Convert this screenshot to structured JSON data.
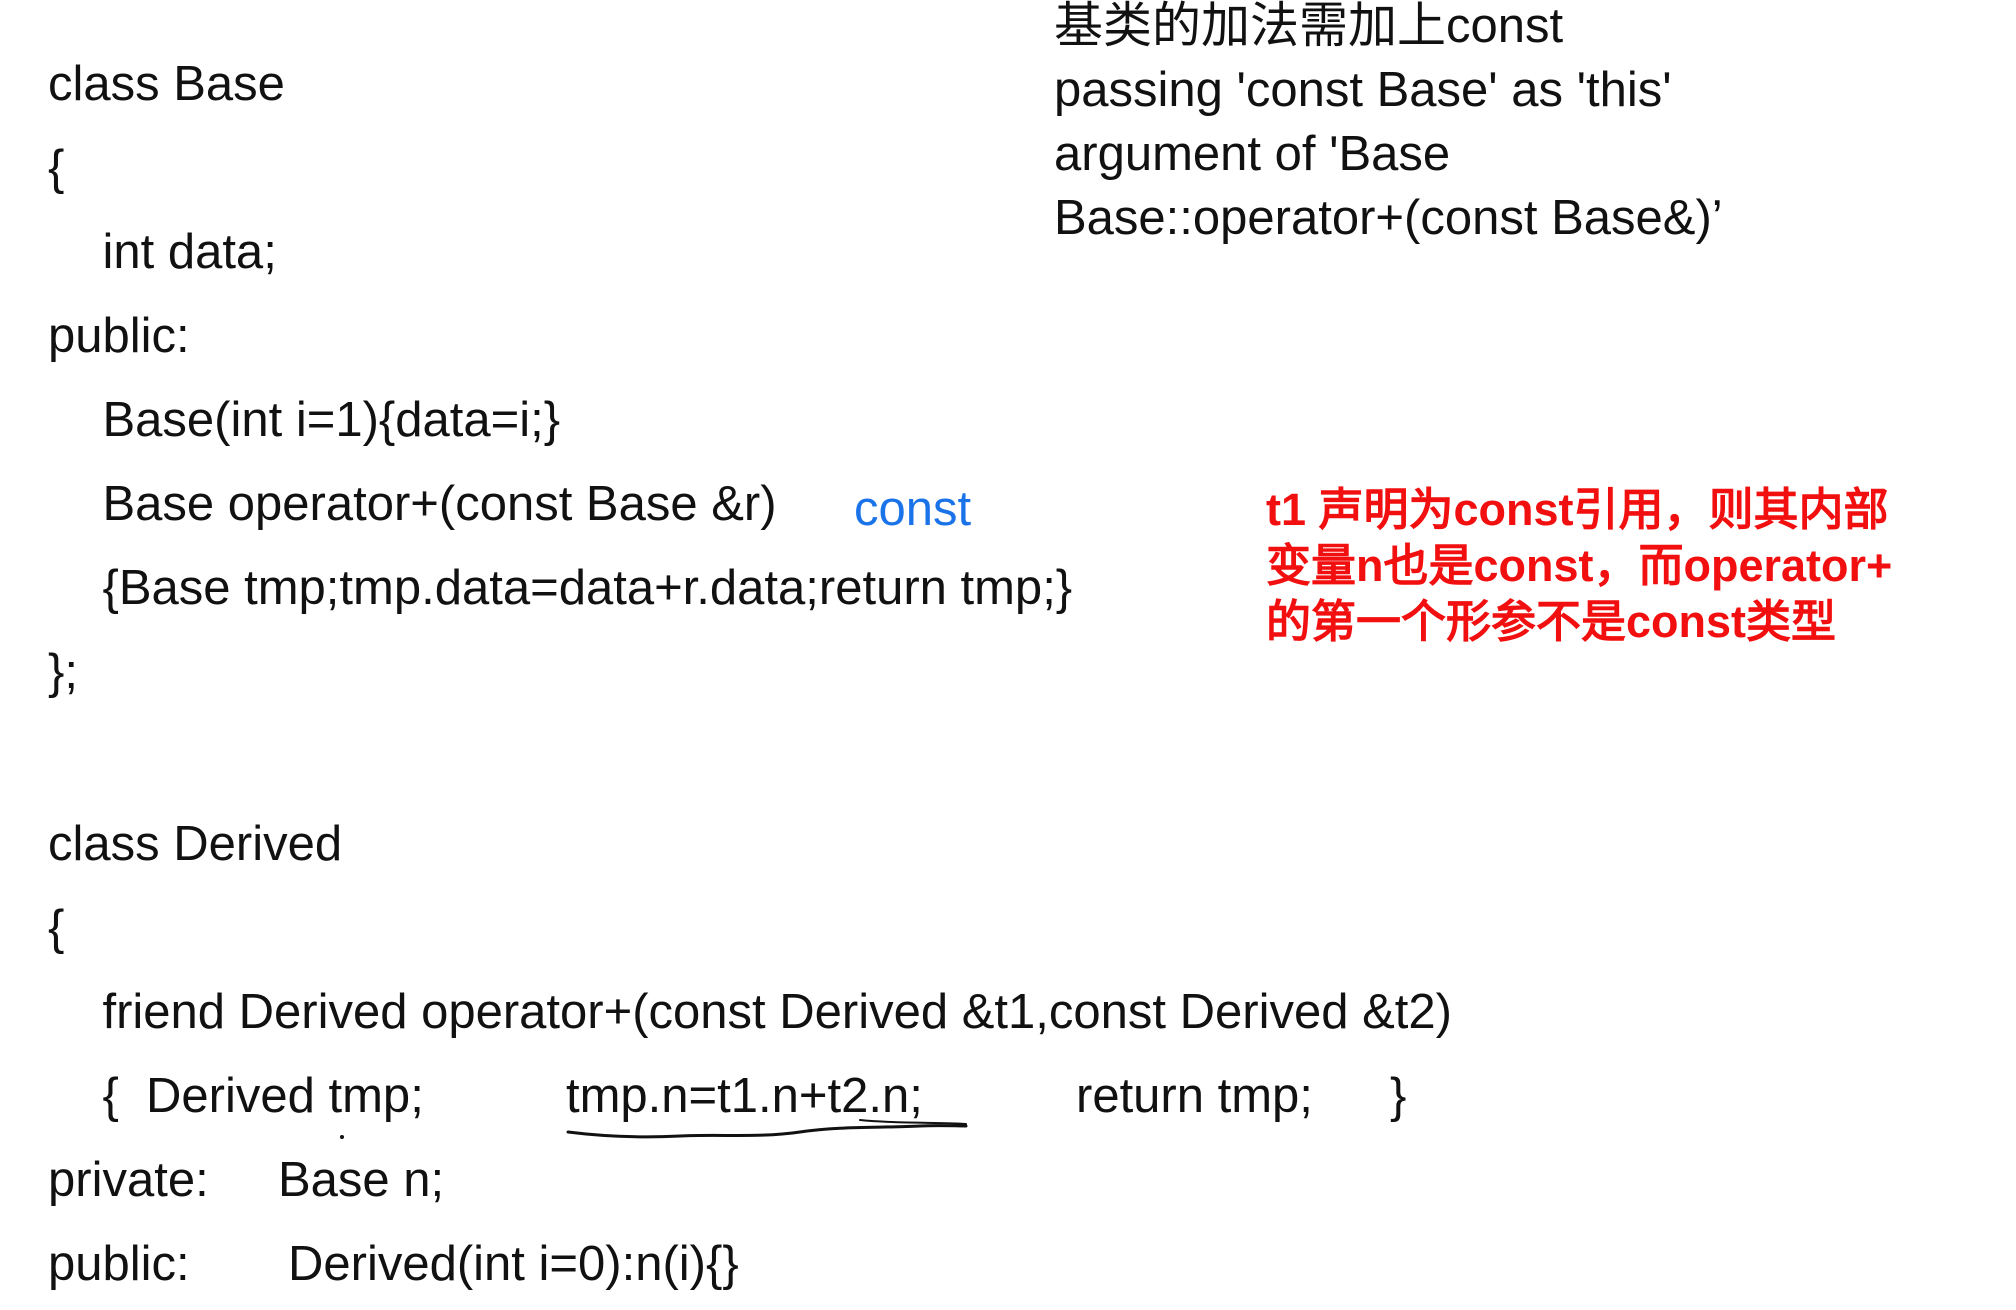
{
  "code": {
    "lines": [
      "class Base",
      "{",
      "    int data;",
      "public:",
      "    Base(int i=1){data=i;}",
      "    Base operator+(const Base &r)",
      "    {Base tmp;tmp.data=data+r.data;return tmp;}",
      "};",
      "class Derived",
      "{",
      "    friend Derived operator+(const Derived &t1,const Derived &t2)",
      "    {  Derived tmp;",
      "tmp.n=t1.n+t2.n;",
      "return tmp;",
      "}",
      "private:",
      "Base n;",
      "public:",
      "Derived(int i=0):n(i){}"
    ]
  },
  "annotations": {
    "const_hint": "const",
    "error_note": [
      "基类的加法需加上const",
      "passing 'const Base' as 'this'",
      "argument of 'Base",
      "Base::operator+(const Base&)’"
    ],
    "red_note": [
      "t1 声明为const引用，则其内部",
      "变量n也是const，而operator+",
      "的第一个形参不是const类型"
    ]
  },
  "colors": {
    "text": "#111111",
    "hint_blue": "#1a73e8",
    "note_red": "#f20f0f"
  }
}
